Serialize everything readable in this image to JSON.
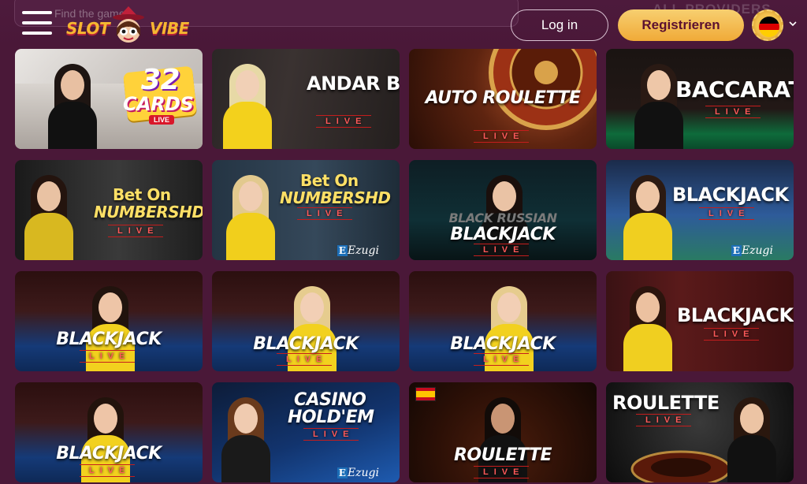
{
  "header": {
    "search_placeholder": "Find the game",
    "providers_label": "ALL PROVIDERS",
    "logo_left": "SLOT",
    "logo_right": "VIBE",
    "login_label": "Log in",
    "register_label": "Registrieren",
    "language": "DE"
  },
  "colors": {
    "background": "#4a1838",
    "register_gradient_top": "#f7cf70",
    "register_gradient_bottom": "#f0aa38",
    "live_red": "#c51d1d"
  },
  "games": [
    {
      "id": "32-cards",
      "title": "32 CARDS",
      "live": "LIVE",
      "provider": ""
    },
    {
      "id": "andar-bahar",
      "title": "ANDAR BAHAR",
      "live": "LIVE",
      "provider": ""
    },
    {
      "id": "auto-roulette",
      "title": "AUTO ROULETTE",
      "live": "LIVE",
      "provider": ""
    },
    {
      "id": "baccarat",
      "title": "BACCARAT",
      "live": "LIVE",
      "provider": ""
    },
    {
      "id": "bet-on-numbers-hd-1",
      "title_line1": "Bet On",
      "title_line2": "NUMBERSHD",
      "live": "LIVE",
      "provider": ""
    },
    {
      "id": "bet-on-numbers-hd-2",
      "title_line1": "Bet On",
      "title_line2": "NUMBERSHD",
      "live": "LIVE",
      "provider": "Ezugi"
    },
    {
      "id": "black-russian-blackjack",
      "title_line1": "BLACK RUSSIAN",
      "title_line2": "BLACKJACK",
      "live": "LIVE",
      "provider": ""
    },
    {
      "id": "blackjack-ezugi",
      "title": "BLACKJACK",
      "live": "LIVE",
      "provider": "Ezugi"
    },
    {
      "id": "blackjack-1",
      "title": "BLACKJACK",
      "live": "LIVE",
      "provider": ""
    },
    {
      "id": "blackjack-2",
      "title": "BLACKJACK",
      "live": "LIVE",
      "provider": ""
    },
    {
      "id": "blackjack-3",
      "title": "BLACKJACK",
      "live": "LIVE",
      "provider": ""
    },
    {
      "id": "blackjack-4",
      "title": "BLACKJACK",
      "live": "LIVE",
      "provider": ""
    },
    {
      "id": "blackjack-5",
      "title": "BLACKJACK",
      "live": "LIVE",
      "provider": ""
    },
    {
      "id": "casino-holdem",
      "title_line1": "CASINO",
      "title_line2": "HOLD'EM",
      "live": "LIVE",
      "provider": "Ezugi"
    },
    {
      "id": "roulette-es",
      "title": "ROULETTE",
      "live": "LIVE",
      "provider": ""
    },
    {
      "id": "roulette",
      "title": "ROULETTE",
      "live": "LIVE",
      "provider": ""
    }
  ],
  "badges": {
    "cards_number": "32",
    "cards_word": "CARDS",
    "cards_live": "LIVE"
  }
}
